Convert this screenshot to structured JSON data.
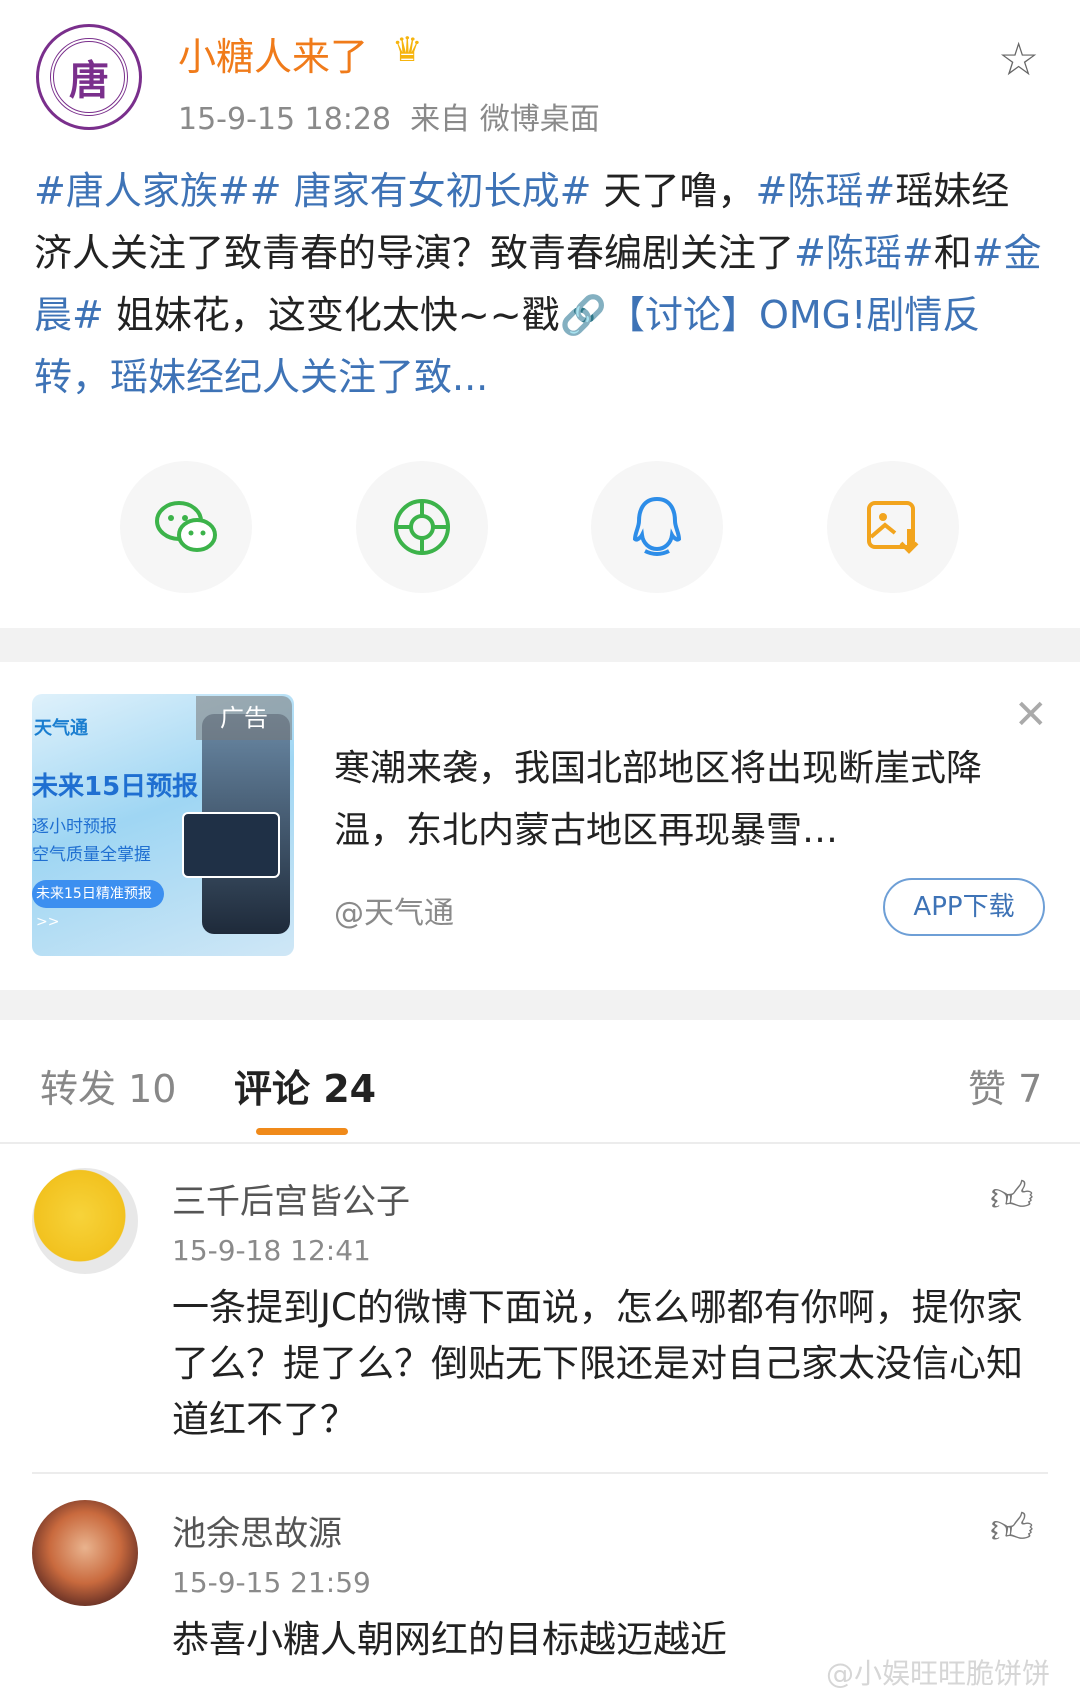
{
  "post": {
    "username": "小糖人来了",
    "avatar_char": "唐",
    "time": "15-9-15 18:28",
    "source": "来自 微博桌面",
    "segments": [
      {
        "text": "#唐人家族#",
        "type": "tag"
      },
      {
        "text": "# 唐家有女初长成#",
        "type": "tag"
      },
      {
        "text": " 天了噜，",
        "type": "text"
      },
      {
        "text": "#陈瑶#",
        "type": "tag"
      },
      {
        "text": "瑶妹经济人关注了致青春的导演？致青春编剧关注了",
        "type": "text"
      },
      {
        "text": "#陈瑶#",
        "type": "tag"
      },
      {
        "text": "和",
        "type": "text"
      },
      {
        "text": "#金晨#",
        "type": "tag"
      },
      {
        "text": " 姐妹花，这变化太快~~戳",
        "type": "text"
      },
      {
        "text": "🔗",
        "type": "link"
      },
      {
        "text": "【讨论】OMG!剧情反转，瑶妹经纪人关注了致...",
        "type": "link"
      }
    ]
  },
  "share": {
    "wechat_icon": "wechat-icon",
    "moments_icon": "moments-icon",
    "qq_icon": "qq-icon",
    "save_icon": "save-image-icon"
  },
  "ad": {
    "tag": "广告",
    "img_brand": "天气通",
    "img_headline": "未来15日预报",
    "img_line1": "逐小时预报",
    "img_line2": "空气质量全掌握",
    "img_button": "未来15日精准预报 >>",
    "title": "寒潮来袭，我国北部地区将出现断崖式降温，东北内蒙古地区再现暴雪…",
    "source": "@天气通",
    "button": "APP下载"
  },
  "tabs": {
    "repost": "转发 10",
    "comments": "评论 24",
    "likes": "赞 7"
  },
  "comments": [
    {
      "name": "三千后宫皆公子",
      "time": "15-9-18 12:41",
      "text": "一条提到JC的微博下面说，怎么哪都有你啊，提你家了么？提了么？倒贴无下限还是对自己家太没信心知道红不了？"
    },
    {
      "name": "池余思故源",
      "time": "15-9-15 21:59",
      "text": "恭喜小糖人朝网红的目标越迈越近"
    }
  ],
  "watermark": "@小娱旺旺脆饼饼"
}
